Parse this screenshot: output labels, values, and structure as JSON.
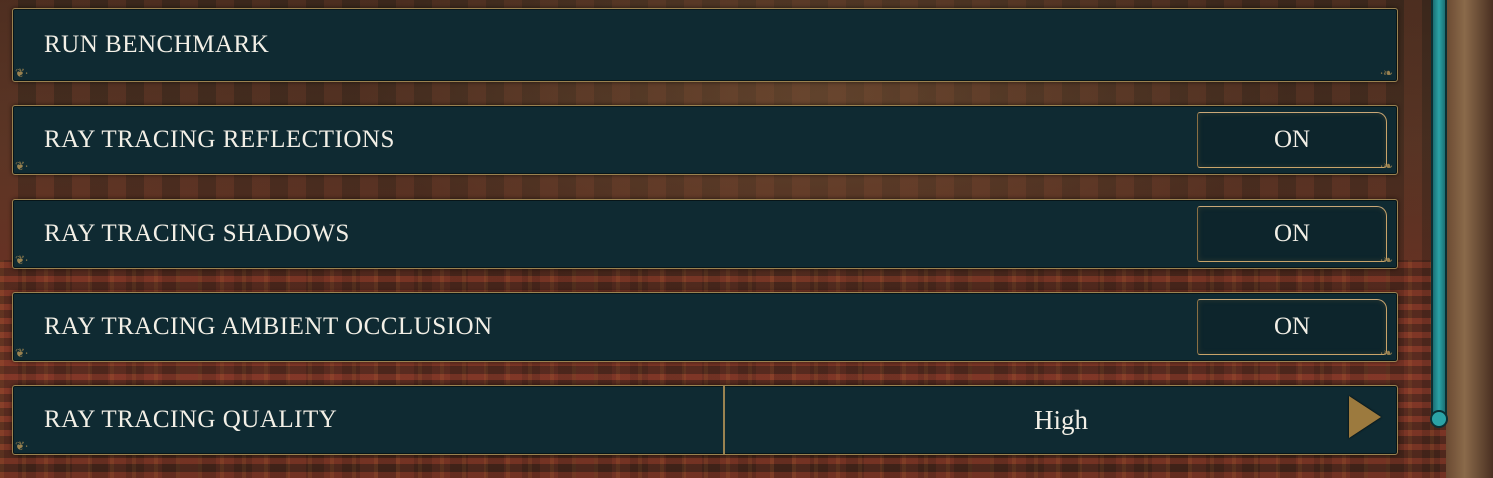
{
  "settings": {
    "run_benchmark": {
      "label": "RUN BENCHMARK"
    },
    "rt_reflections": {
      "label": "RAY TRACING REFLECTIONS",
      "value": "ON"
    },
    "rt_shadows": {
      "label": "RAY TRACING SHADOWS",
      "value": "ON"
    },
    "rt_ao": {
      "label": "RAY TRACING AMBIENT OCCLUSION",
      "value": "ON"
    },
    "rt_quality": {
      "label": "RAY TRACING QUALITY",
      "value": "High"
    }
  },
  "colors": {
    "panel": "#0f2a32",
    "border_gold": "#9a8250",
    "text": "#f2efe6",
    "scrollbar": "#2ba3a6"
  },
  "icons": {
    "flourish_left": "ornament-left-icon",
    "flourish_right": "ornament-right-icon",
    "next": "arrow-right-icon"
  }
}
